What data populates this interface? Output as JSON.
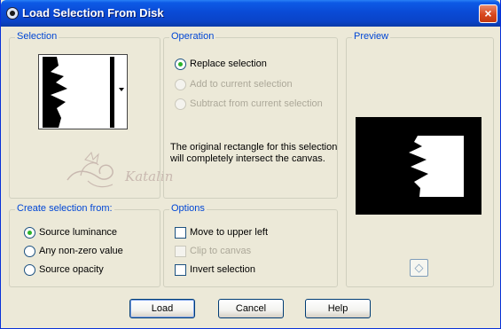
{
  "window": {
    "title": "Load Selection From Disk",
    "close_glyph": "×"
  },
  "selection_group": {
    "label": "Selection"
  },
  "operation_group": {
    "label": "Operation",
    "options": [
      {
        "label": "Replace selection",
        "selected": true,
        "enabled": true
      },
      {
        "label": "Add to current selection",
        "selected": false,
        "enabled": false
      },
      {
        "label": "Subtract from current selection",
        "selected": false,
        "enabled": false
      }
    ],
    "info_text": "The original rectangle for this selection will completely intersect the canvas."
  },
  "preview_group": {
    "label": "Preview",
    "nav_icon": "pan-navigator-icon"
  },
  "create_from_group": {
    "label": "Create selection from:",
    "options": [
      {
        "label": "Source luminance",
        "selected": true
      },
      {
        "label": "Any non-zero value",
        "selected": false
      },
      {
        "label": "Source opacity",
        "selected": false
      }
    ]
  },
  "options_group": {
    "label": "Options",
    "checks": [
      {
        "label": "Move to upper left",
        "checked": false,
        "enabled": true
      },
      {
        "label": "Clip to canvas",
        "checked": false,
        "enabled": false
      },
      {
        "label": "Invert selection",
        "checked": false,
        "enabled": true
      }
    ]
  },
  "watermark": {
    "text": "Katalin"
  },
  "buttons": {
    "load": "Load",
    "cancel": "Cancel",
    "help": "Help"
  },
  "colors": {
    "accent": "#0046d5",
    "titlebar": "#0a4bd6",
    "radio_dot": "#2bb32b"
  }
}
